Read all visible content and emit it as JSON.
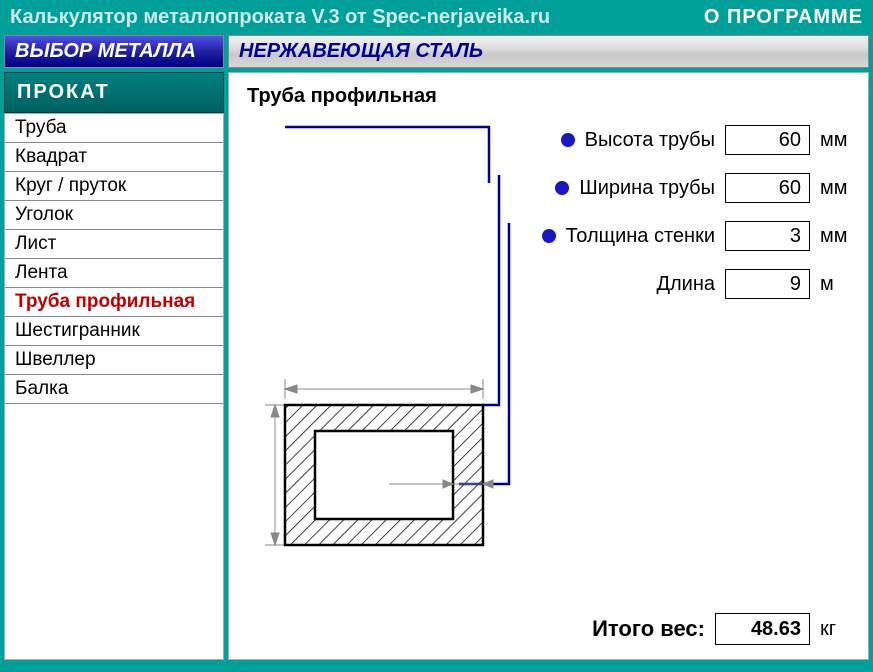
{
  "titlebar": {
    "title": "Калькулятор металлопроката V.3 от Spec-nerjaveika.ru",
    "about": "О ПРОГРАММЕ"
  },
  "header": {
    "select_label": "ВЫБОР МЕТАЛЛА",
    "material": "НЕРЖАВЕЮЩАЯ СТАЛЬ"
  },
  "sidebar": {
    "header": "ПРОКАТ",
    "items": [
      {
        "label": "Труба",
        "active": false
      },
      {
        "label": "Квадрат",
        "active": false
      },
      {
        "label": "Круг / пруток",
        "active": false
      },
      {
        "label": "Уголок",
        "active": false
      },
      {
        "label": "Лист",
        "active": false
      },
      {
        "label": "Лента",
        "active": false
      },
      {
        "label": "Труба профильная",
        "active": true
      },
      {
        "label": "Шестигранник",
        "active": false
      },
      {
        "label": "Швеллер",
        "active": false
      },
      {
        "label": "Балка",
        "active": false
      }
    ]
  },
  "main": {
    "title": "Труба профильная",
    "params": [
      {
        "label": "Высота трубы",
        "value": "60",
        "unit": "мм",
        "bullet": true
      },
      {
        "label": "Ширина трубы",
        "value": "60",
        "unit": "мм",
        "bullet": true
      },
      {
        "label": "Толщина стенки",
        "value": "3",
        "unit": "мм",
        "bullet": true
      },
      {
        "label": "Длина",
        "value": "9",
        "unit": "м",
        "bullet": false
      }
    ],
    "result": {
      "label": "Итого вес:",
      "value": "48.63",
      "unit": "кг"
    }
  }
}
